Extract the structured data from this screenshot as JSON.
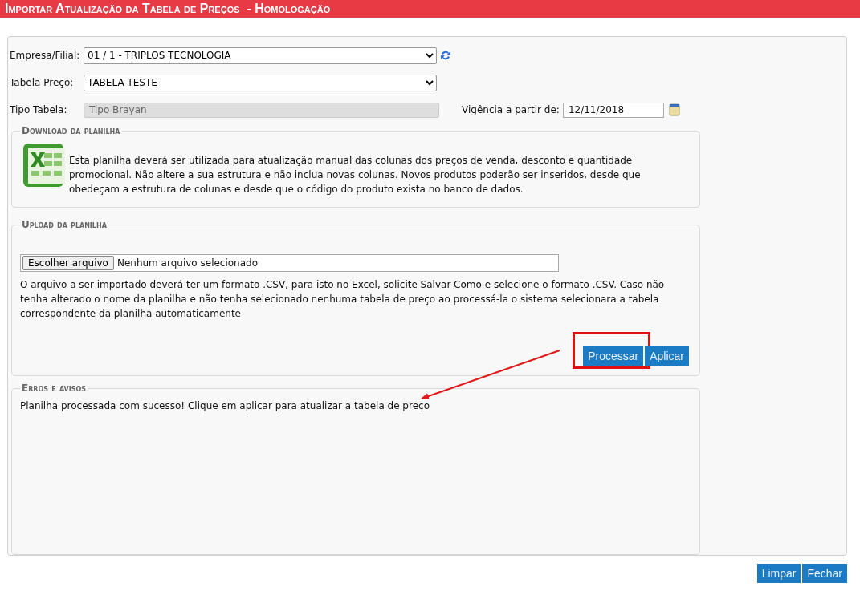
{
  "header": {
    "title": "Importar Atualização da Tabela de Preços  - Homologação"
  },
  "filters": {
    "company": {
      "label": "Empresa/Filial:",
      "value": "01 / 1 - TRIPLOS TECNOLOGIA"
    },
    "price_table": {
      "label": "Tabela Preço:",
      "value": "TABELA TESTE"
    },
    "table_type": {
      "label": "Tipo Tabela:",
      "value": "Tipo Brayan",
      "disabled": true
    },
    "valid_from": {
      "label": "Vigência a partir de:",
      "value": "12/11/2018"
    }
  },
  "download": {
    "legend": "Download da planilha",
    "text": "Esta planilha deverá ser utilizada para atualização manual das colunas dos preços de venda, desconto e quantidade promocional. Não altere a sua estrutura e não inclua novas colunas. Novos produtos poderão ser inseridos, desde que obedeçam a estrutura de colunas e desde que o código do produto exista no banco de dados."
  },
  "upload": {
    "legend": "Upload da planilha",
    "choose_button": "Escolher arquivo",
    "file_status": "Nenhum arquivo selecionado",
    "text": "O arquivo a ser importado deverá ter um formato .CSV, para isto no Excel, solicite Salvar Como e selecione o formato .CSV. Caso não tenha alterado o nome da planilha e não tenha selecionado nenhuma tabela de preço ao processá-la o sistema selecionara a tabela correspondente da planilha automaticamente",
    "buttons": [
      {
        "label": "Processar",
        "highlighted": true
      },
      {
        "label": "Aplicar",
        "highlighted": false
      }
    ]
  },
  "messages": {
    "legend": "Erros e avisos",
    "text": "Planilha processada com sucesso! Clique em aplicar para atualizar a tabela de preço"
  },
  "footer_buttons": [
    "Limpar",
    "Fechar"
  ]
}
